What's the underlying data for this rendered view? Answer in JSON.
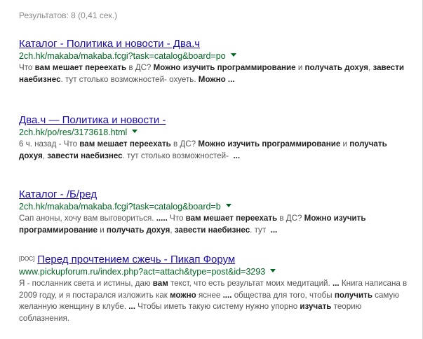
{
  "stats": "Результатов: 8 (0,41 сек.)",
  "results": [
    {
      "badge": "",
      "title": "Каталог - Политика и новости - Два.ч",
      "url": "2ch.hk/makaba/makaba.fcgi?task=catalog&board=po",
      "snippet_html": "Что <b>вам мешает переехать</b> в ДС? <b>Можно изучить программирование</b> и <b>получать дохуя</b>, <b>завести наебизнес</b>. тут столько возможностей- охуеть. <b>Можно ...</b>"
    },
    {
      "badge": "",
      "title": "Два.ч — Политика и новости -",
      "url": "2ch.hk/po/res/3173618.html",
      "snippet_html": "6 ч. назад - Что <b>вам мешает переехать</b> в ДС? <b>Можно изучить программирование</b> и <b>получать дохуя</b>, <b>завести наебизнес</b>. тут столько возможностей- &nbsp;<b>...</b>"
    },
    {
      "badge": "",
      "title": "Каталог - /Б/ред",
      "url": "2ch.hk/makaba/makaba.fcgi?task=catalog&board=b",
      "snippet_html": "Сап аноны, хочу вам выговориться. <b>.....</b> Что <b>вам мешает переехать</b> в ДС? <b>Можно изучить программирование</b> и <b>получать дохуя</b>, <b>завести наебизнес</b>. тут &nbsp;<b>...</b>"
    },
    {
      "badge": "[DOC]",
      "title": "Перед прочтением сжечь - Пикап Форум",
      "url": "www.pickupforum.ru/index.php?act=attach&type=post&id=3293",
      "snippet_html": "Я - посланник света и истины, даю <b>вам</b> текст, что есть результат моих медитаций. <b>...</b> Книга написана в 2009 году, и я постарался изложить как <b>можно</b> яснее <b>....</b> общества для того, чтобы <b>получить</b> самую желанную женщину в клубе. <b>...</b> Чтобы иметь такую систему нужно упорно <b>изучать</b> теорию соблазнения."
    }
  ]
}
